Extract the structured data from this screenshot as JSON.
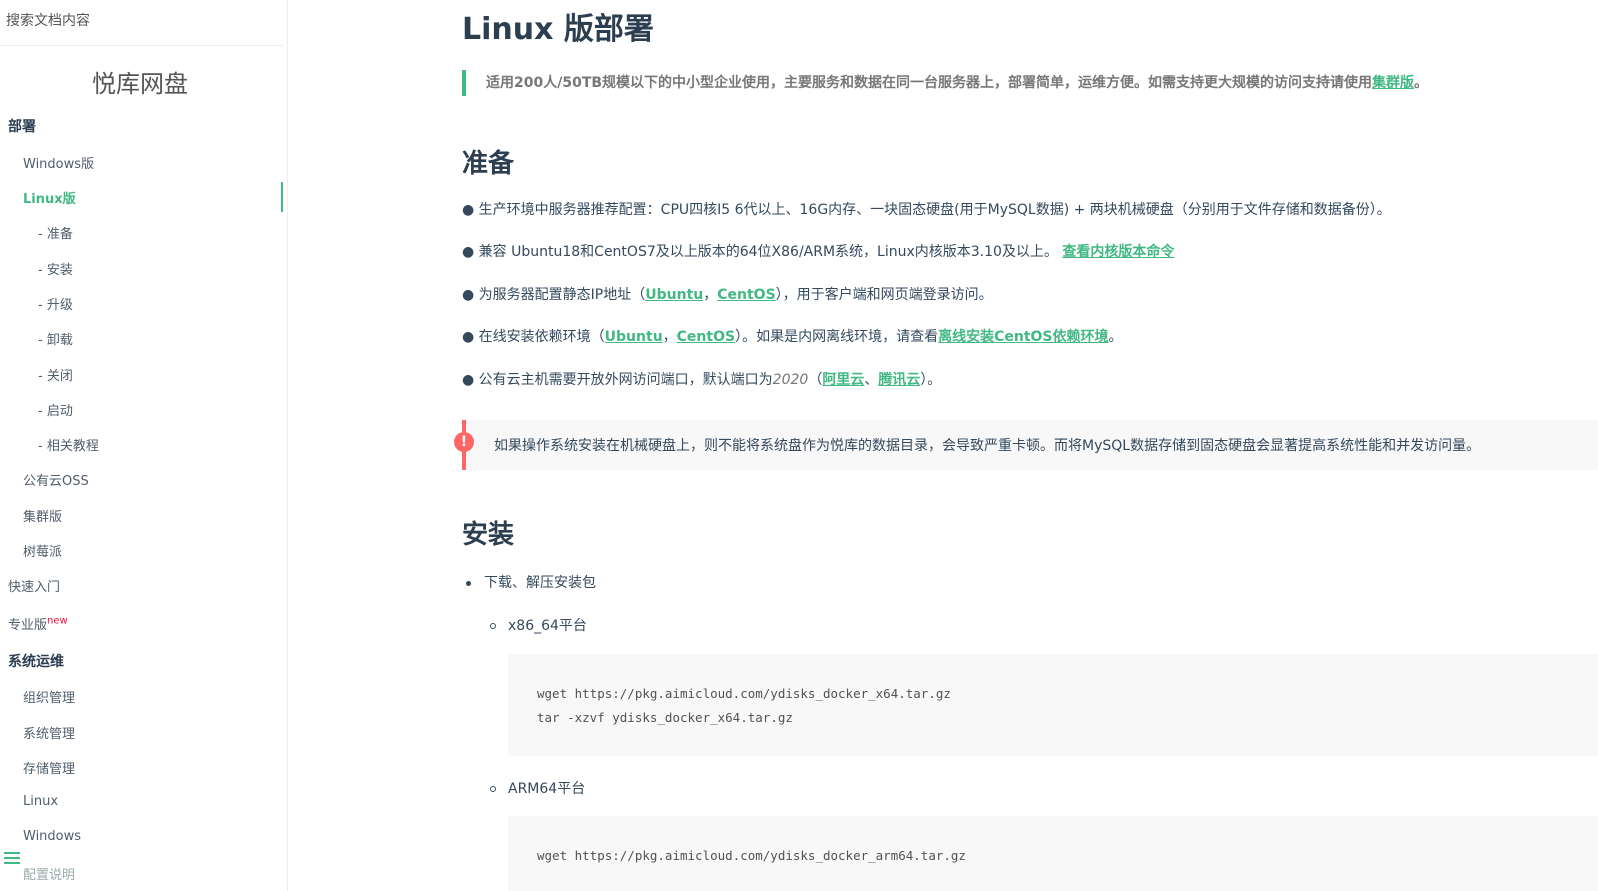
{
  "sidebar": {
    "search_placeholder": "搜索文档内容",
    "app_name": "悦库网盘",
    "items": [
      {
        "label": "部署"
      },
      {
        "label": "Windows版"
      },
      {
        "label": "Linux版"
      },
      {
        "label": "- 准备"
      },
      {
        "label": "- 安装"
      },
      {
        "label": "- 升级"
      },
      {
        "label": "- 卸载"
      },
      {
        "label": "- 关闭"
      },
      {
        "label": "- 启动"
      },
      {
        "label": "- 相关教程"
      },
      {
        "label": "公有云OSS"
      },
      {
        "label": "集群版"
      },
      {
        "label": "树莓派"
      },
      {
        "label": "快速入门"
      },
      {
        "label": "专业版",
        "badge": "new"
      },
      {
        "label": "系统运维"
      },
      {
        "label": "组织管理"
      },
      {
        "label": "系统管理"
      },
      {
        "label": "存储管理"
      },
      {
        "label": "Linux"
      },
      {
        "label": "Windows"
      },
      {
        "label": "配置说明"
      }
    ],
    "accent_color": "#42b983"
  },
  "main": {
    "title": "Linux 版部署",
    "quote": {
      "text": "适用200人/50TB规模以下的中小型企业使用，主要服务和数据在同一台服务器上，部署简单，运维方便。如需支持更大规模的访问支持请使用",
      "link": "集群版",
      "end": "。"
    },
    "prepare": {
      "heading": "准备",
      "p1": "● 生产环境中服务器推荐配置：CPU四核I5 6代以上、16G内存、一块固态硬盘(用于MySQL数据) + 两块机械硬盘（分别用于文件存储和数据备份）。",
      "p2_text": "● 兼容 Ubuntu18和CentOS7及以上版本的64位X86/ARM系统，Linux内核版本3.10及以上。",
      "p2_link": "查看内核版本命令",
      "p3_a": "● 为服务器配置静态IP地址（",
      "p3_link1": "Ubuntu",
      "p3_sep": "，",
      "p3_link2": "CentOS",
      "p3_b": "），用于客户端和网页端登录访问。",
      "p4_a": "● 在线安装依赖环境（",
      "p4_link1": "Ubuntu",
      "p4_sep": "，",
      "p4_link2": "CentOS",
      "p4_b": "）。如果是内网离线环境，请查看",
      "p4_link3": "离线安装CentOS依赖环境",
      "p4_c": "。",
      "p5_a": "● 公有云主机需要开放外网访问端口，默认端口为",
      "p5_port": "2020",
      "p5_b": "（",
      "p5_link1": "阿里云",
      "p5_sep": "、",
      "p5_link2": "腾讯云",
      "p5_c": "）。"
    },
    "warning": {
      "icon": "!",
      "text": "如果操作系统安装在机械硬盘上，则不能将系统盘作为悦库的数据目录，会导致严重卡顿。而将MySQL数据存储到固态硬盘会显著提高系统性能和并发访问量。",
      "color": "#f66"
    },
    "install": {
      "heading": "安装",
      "step1": "下载、解压安装包",
      "x86_label": "x86_64平台",
      "x86_code": [
        "wget https://pkg.aimicloud.com/ydisks_docker_x64.tar.gz",
        "tar -xzvf ydisks_docker_x64.tar.gz"
      ],
      "arm_label": "ARM64平台",
      "arm_code": [
        "wget https://pkg.aimicloud.com/ydisks_docker_arm64.tar.gz"
      ]
    }
  }
}
